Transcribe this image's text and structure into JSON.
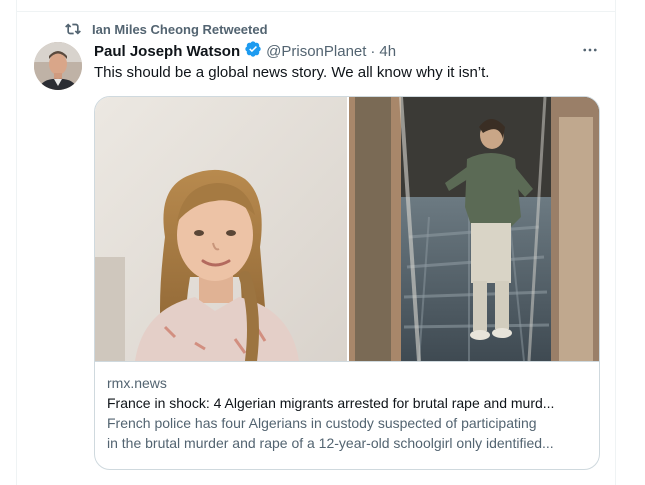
{
  "retweet": {
    "label": "Ian Miles Cheong Retweeted",
    "icon": "retweet-icon"
  },
  "author": {
    "display_name": "Paul Joseph Watson",
    "verified": true,
    "handle": "@PrisonPlanet",
    "separator": "·",
    "time": "4h"
  },
  "tweet": {
    "text": "This should be a global news story. We all know why it isn’t."
  },
  "card": {
    "domain": "rmx.news",
    "title": "France in shock: 4 Algerian migrants arrested for brutal rape and murd...",
    "description_line1": "French police has four Algerians in custody suspected of participating",
    "description_line2": "in the brutal murder and rape of a 12-year-old schoolgirl only identified..."
  },
  "colors": {
    "accent": "#1d9bf0",
    "secondary_text": "#536471",
    "primary_text": "#0f1419",
    "border": "#cfd9de"
  }
}
